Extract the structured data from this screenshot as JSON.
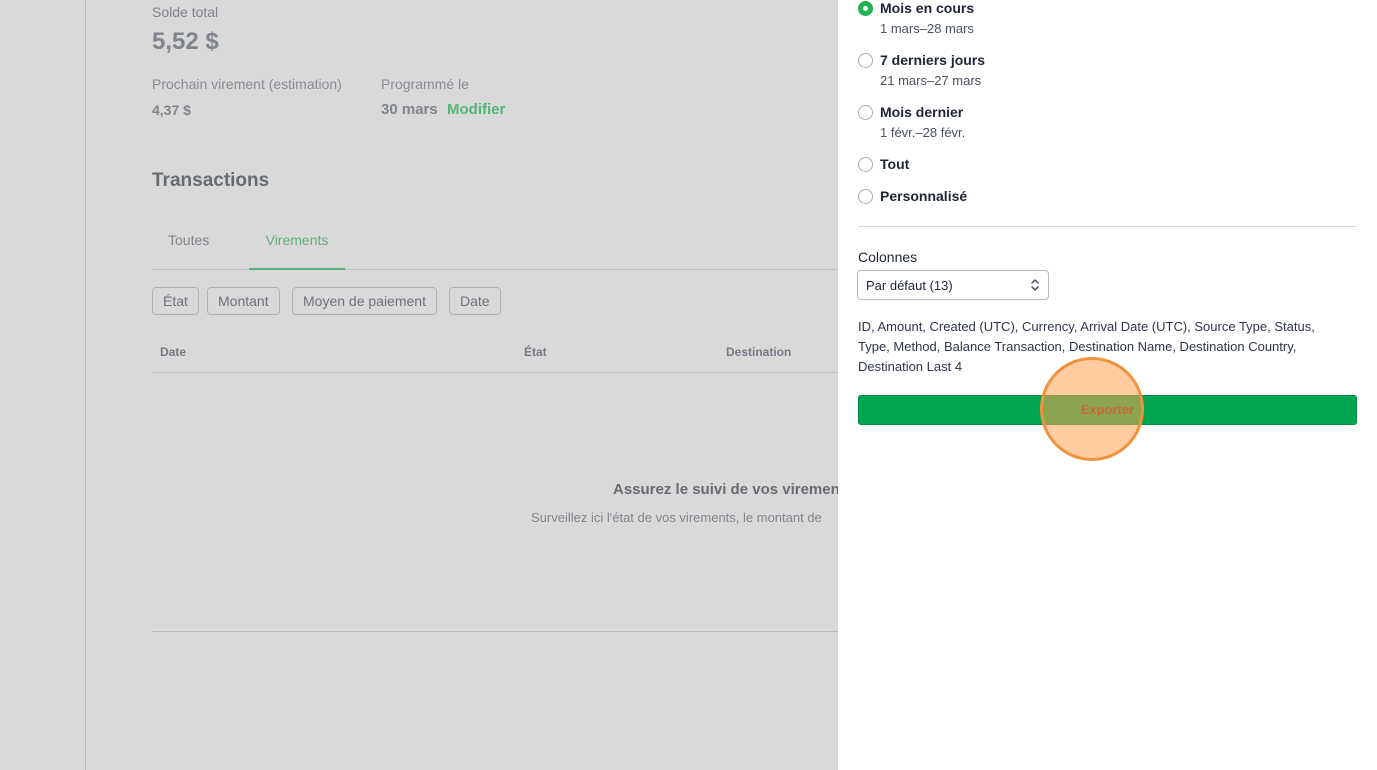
{
  "balance": {
    "label": "Solde total",
    "value": "5,52 $",
    "next_label": "Prochain virement (estimation)",
    "next_value": "4,37 $",
    "scheduled_label": "Programmé le",
    "scheduled_value": "30 mars",
    "modify_link": "Modifier"
  },
  "transactions": {
    "title": "Transactions",
    "tabs": [
      {
        "label": "Toutes",
        "active": false
      },
      {
        "label": "Virements",
        "active": true
      }
    ],
    "filters": [
      "État",
      "Montant",
      "Moyen de paiement",
      "Date"
    ],
    "columns": [
      "Date",
      "État",
      "Destination"
    ],
    "empty_title": "Assurez le suivi de vos virements",
    "empty_subtitle": "Surveillez ici l'état de vos virements, le montant de"
  },
  "export_panel": {
    "date_options": [
      {
        "label": "Mois en cours",
        "range": "1 mars–28 mars",
        "selected": true
      },
      {
        "label": "7 derniers jours",
        "range": "21 mars–27 mars",
        "selected": false
      },
      {
        "label": "Mois dernier",
        "range": "1 févr.–28 févr.",
        "selected": false
      },
      {
        "label": "Tout",
        "range": "",
        "selected": false
      },
      {
        "label": "Personnalisé",
        "range": "",
        "selected": false
      }
    ],
    "columns_label": "Colonnes",
    "columns_select_value": "Par défaut (13)",
    "columns_description": "ID, Amount, Created (UTC), Currency, Arrival Date (UTC), Source Type, Status, Type, Method, Balance Transaction, Destination Name, Destination Country, Destination Last 4",
    "export_button": "Exporter"
  },
  "colors": {
    "accent_green": "#00a651",
    "radio_checked": "#20b350",
    "link_green": "#0bbf4f",
    "click_marker": "#f0933f"
  },
  "icons": {
    "select_chevrons": "chevron-up-down-icon"
  }
}
